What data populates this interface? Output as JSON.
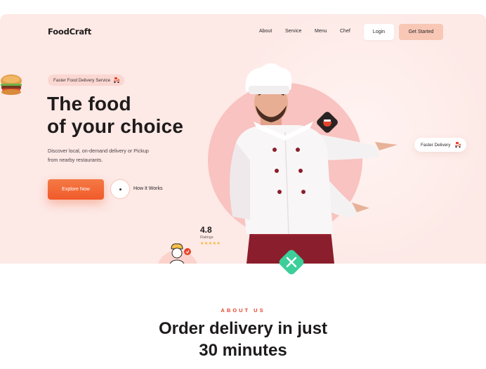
{
  "brand": {
    "logo": "FoodCraft",
    "accent": "#f05a2a",
    "hero_bg": "#fde9e6",
    "button_bg": "#f8c7b6"
  },
  "nav": {
    "items": [
      "About",
      "Service",
      "Menu",
      "Chef"
    ],
    "login": "Login",
    "get_started": "Get Started"
  },
  "hero": {
    "badge": "Faster Food Delivery Service",
    "headline": [
      "The food",
      "of your choice"
    ],
    "subtext": [
      "Discover local, on-demand delivery or Pickup",
      "from nearby restaurants."
    ],
    "explore": "Explore Now",
    "how_it_works": "How It Works",
    "rating_value": "4.8",
    "rating_label": "Ratings",
    "stars": "★★★★★",
    "floating_tag": "Faster Delivery"
  },
  "icons": {
    "badge_icon": "delivery-scooter-icon",
    "tile_icon": "food-bowl-icon",
    "utensils_icon": "fork-knife-icon",
    "avatar_icon": "chef-avatar-icon",
    "burger_icon": "burger-icon",
    "play_icon": "play-icon"
  },
  "about": {
    "label": "ABOUT US",
    "title": [
      "Order delivery in just",
      "30 minutes"
    ]
  }
}
